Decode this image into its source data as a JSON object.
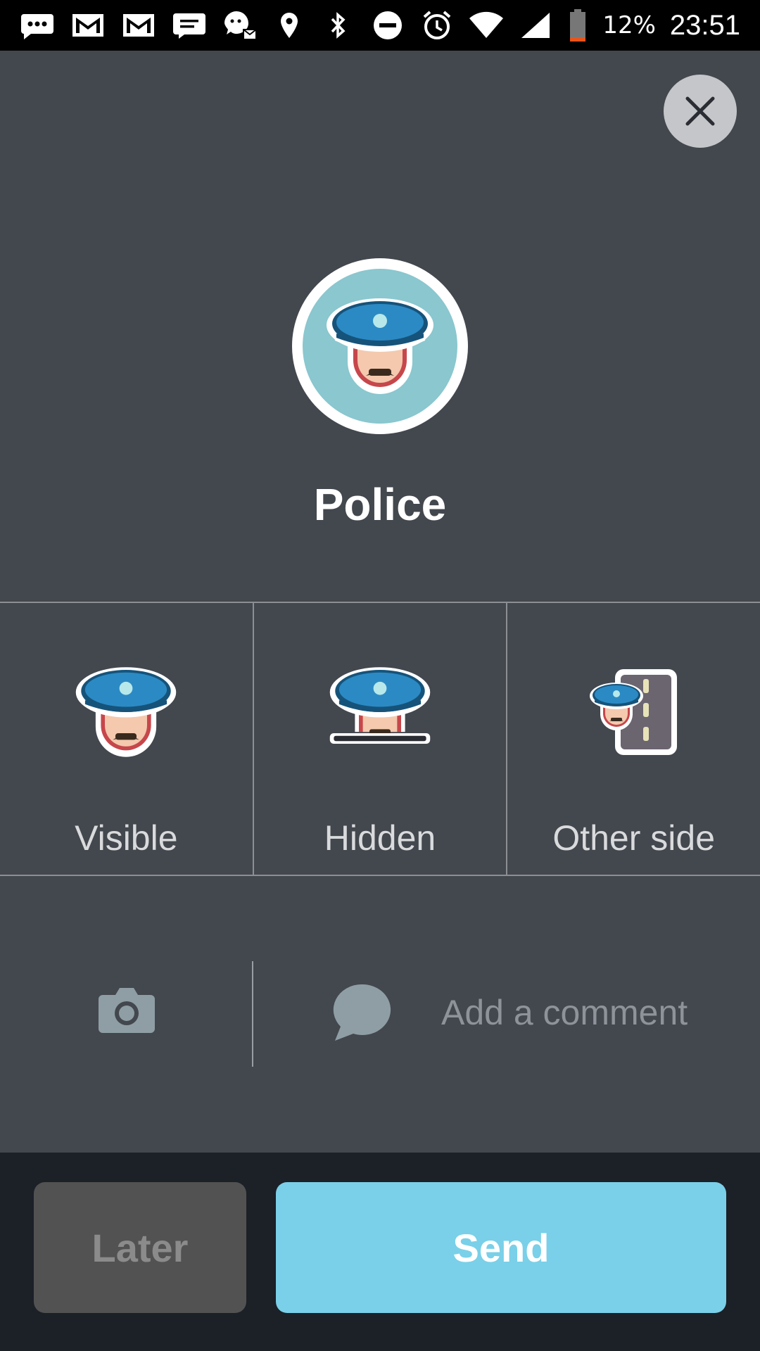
{
  "status_bar": {
    "battery": "12%",
    "time": "23:51",
    "left_icons": [
      "message-icon",
      "gmail-icon",
      "gmail-icon",
      "sms-icon",
      "waze-icon"
    ],
    "right_icons": [
      "location-icon",
      "bluetooth-icon",
      "dnd-icon",
      "alarm-icon",
      "wifi-icon",
      "signal-icon",
      "battery-icon"
    ]
  },
  "report": {
    "title": "Police"
  },
  "options": [
    {
      "label": "Visible",
      "icon": "police-visible-icon"
    },
    {
      "label": "Hidden",
      "icon": "police-hidden-icon"
    },
    {
      "label": "Other side",
      "icon": "police-other-side-icon"
    }
  ],
  "comment": {
    "placeholder": "Add a comment"
  },
  "actions": {
    "later": "Later",
    "send": "Send"
  },
  "colors": {
    "background": "#43474e",
    "footer": "#1c2027",
    "send_button": "#79d0e8",
    "later_button": "#525252",
    "hero_circle": "#8ac7cf",
    "cap_blue": "#2b8ac4"
  }
}
